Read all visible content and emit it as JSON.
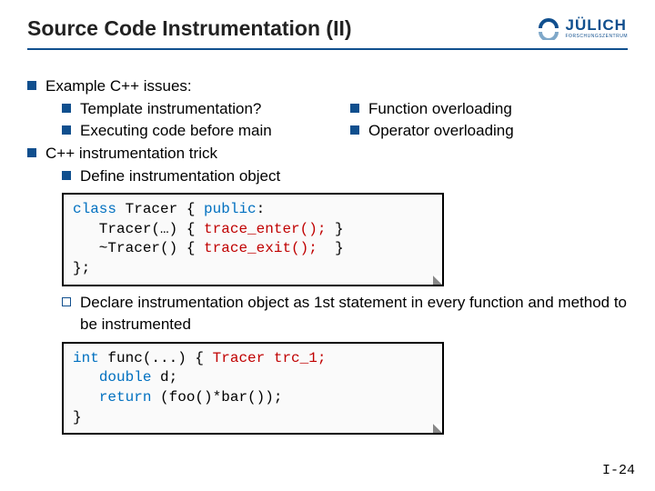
{
  "header": {
    "title": "Source Code Instrumentation (II)",
    "logo_text": "JÜLICH",
    "logo_sub": "FORSCHUNGSZENTRUM"
  },
  "bullets": {
    "b1a": "Example C++ issues:",
    "b2a": "Template instrumentation?",
    "b2b": "Executing code before main",
    "b2c": "Function overloading",
    "b2d": "Operator overloading",
    "b1b": "C++ instrumentation trick",
    "b2e": "Define instrumentation object",
    "b2f_pre": "Declare",
    "b2f_rest": " instrumentation object as 1st statement in every function and method to be instrumented"
  },
  "code1": {
    "l1a": "class",
    "l1b": " Tracer { ",
    "l1c": "public",
    "l1d": ":",
    "l2a": "   Tracer(…) { ",
    "l2b": "trace_enter();",
    "l2c": " }",
    "l3a": "   ~Tracer() { ",
    "l3b": "trace_exit();",
    "l3c": "  }",
    "l4": "};"
  },
  "code2": {
    "l1a": "int",
    "l1b": " func(...) { ",
    "l1c": "Tracer trc_1;",
    "l2a": "   ",
    "l2b": "double",
    "l2c": " d;",
    "l3a": "   ",
    "l3b": "return",
    "l3c": " (foo()*bar());",
    "l4": "}"
  },
  "pagenum": "I-24"
}
